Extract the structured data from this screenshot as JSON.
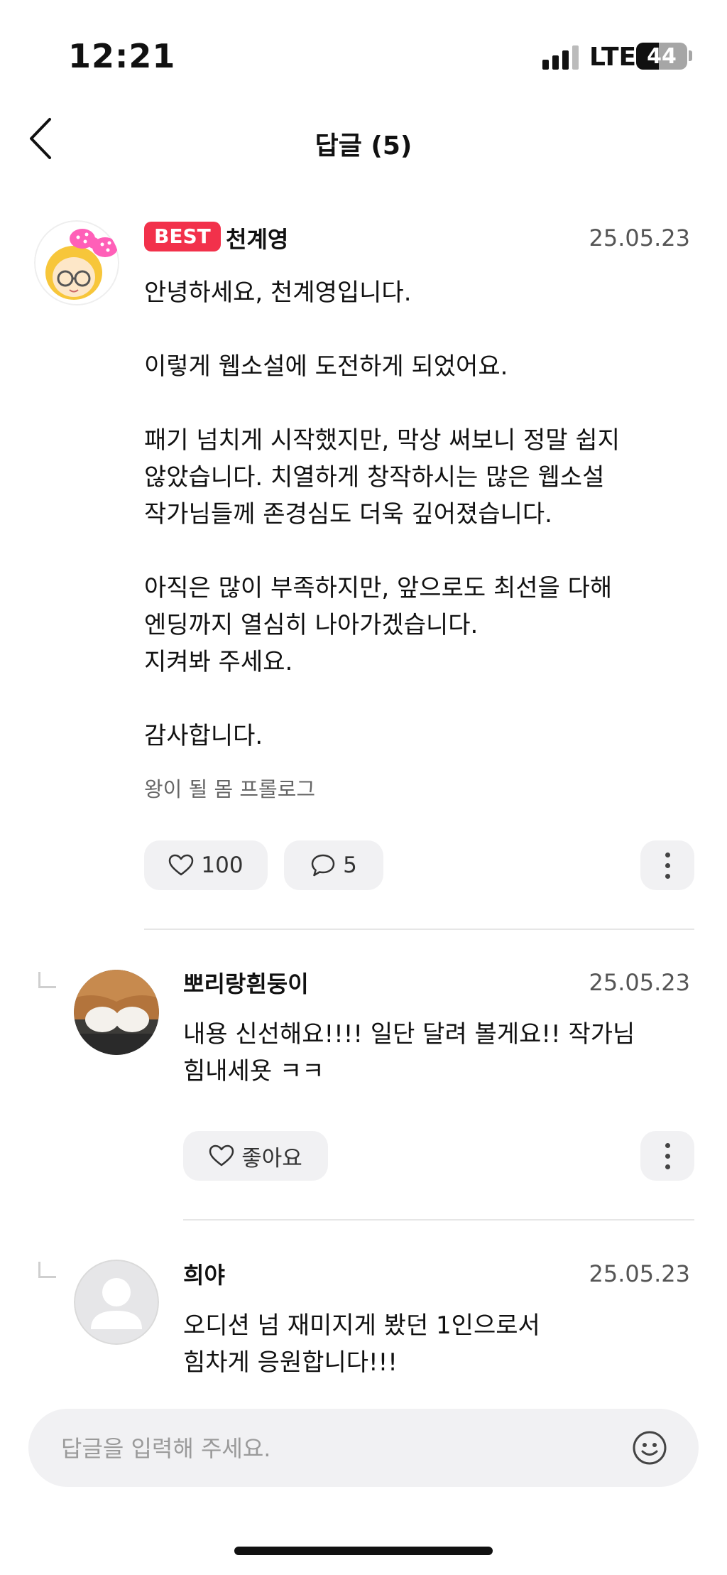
{
  "status_bar": {
    "time": "12:21",
    "network": "LTE",
    "battery": "44",
    "battery_level": 0.44
  },
  "header": {
    "title": "답글 (5)",
    "back_icon": "chevron-left-icon"
  },
  "main_comment": {
    "badge": "BEST",
    "author": "천계영",
    "date": "25.05.23",
    "body": "안녕하세요, 천계영입니다.\n\n이렇게 웹소설에 도전하게 되었어요.\n\n패기 넘치게 시작했지만, 막상 써보니 정말 쉽지\n않았습니다. 치열하게 창작하시는 많은 웹소설\n작가님들께 존경심도 더욱 깊어졌습니다.\n\n아직은 많이 부족하지만, 앞으로도 최선을 다해\n엔딩까지 열심히 나아가겠습니다.\n지켜봐 주세요.\n\n감사합니다.",
    "source": "왕이 될 몸 프롤로그",
    "likes": "100",
    "replies": "5"
  },
  "replies": [
    {
      "author": "뽀리랑흰둥이",
      "date": "25.05.23",
      "body": "내용 신선해요!!!! 일단 달려 볼게요!! 작가님\n힘내세욧 ㅋㅋ",
      "like_label": "좋아요"
    },
    {
      "author": "희야",
      "date": "25.05.23",
      "body": "오디션 넘 재미지게 봤던 1인으로서\n힘차게 응원합니다!!!"
    }
  ],
  "input": {
    "placeholder": "답글을 입력해 주세요."
  },
  "colors": {
    "best_badge": "#f2314b",
    "button_bg": "#f1f1f3",
    "accent_pink": "#ff5fb8"
  }
}
